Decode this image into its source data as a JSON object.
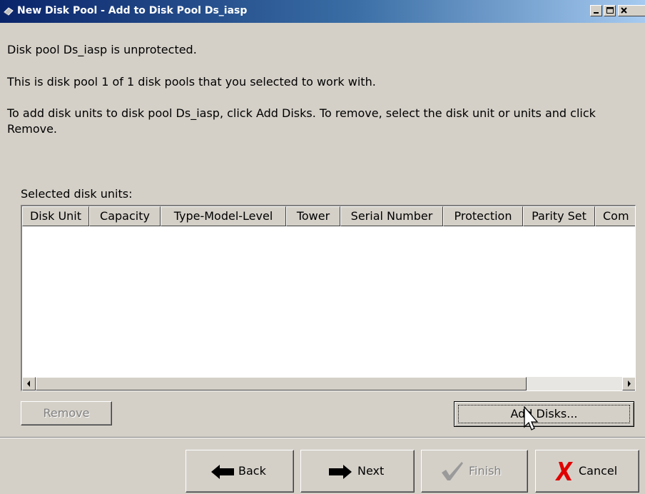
{
  "window": {
    "title": "New Disk Pool - Add to Disk Pool Ds_iasp",
    "controls": {
      "minimize": "minimize-icon",
      "maximize": "maximize-icon",
      "close": "close-icon"
    }
  },
  "messages": {
    "line1": "Disk pool Ds_iasp is unprotected.",
    "line2": "This is disk pool 1 of 1 disk pools that you selected to work with.",
    "line3": "To add disk units to disk pool Ds_iasp, click Add Disks. To remove, select the disk unit or units and click Remove."
  },
  "table": {
    "label": "Selected disk units:",
    "columns": [
      "Disk Unit",
      "Capacity",
      "Type-Model-Level",
      "Tower",
      "Serial Number",
      "Protection",
      "Parity Set",
      "Com"
    ],
    "rows": []
  },
  "buttons": {
    "remove": "Remove",
    "add_disks": "Add Disks...",
    "back": "Back",
    "next": "Next",
    "finish": "Finish",
    "cancel": "Cancel"
  },
  "colors": {
    "titlebar_start": "#0a246a",
    "titlebar_end": "#a6caf0",
    "dialog_bg": "#d4d0c8",
    "cancel_x": "#e00000",
    "finish_check": "#9a9a9a"
  }
}
